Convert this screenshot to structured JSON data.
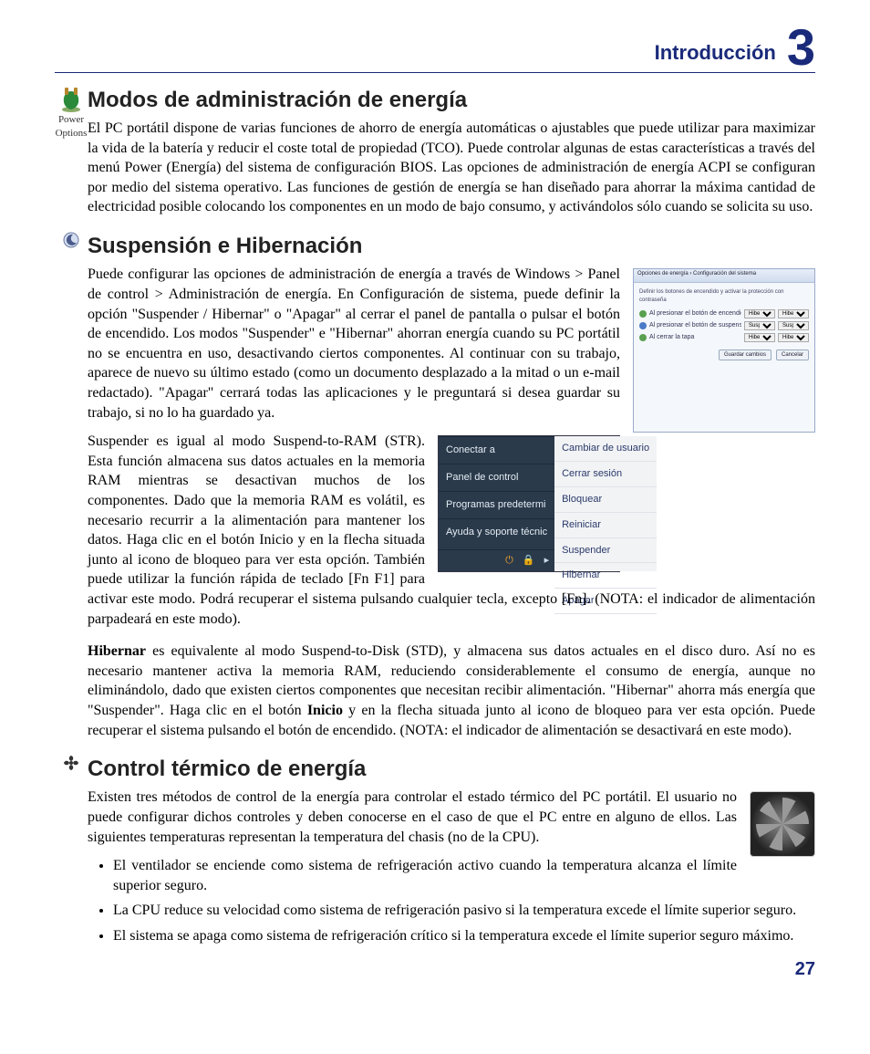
{
  "header": {
    "title": "Introducción",
    "chapter_number": "3"
  },
  "page_number": "27",
  "icons": {
    "power_options_caption_line1": "Power",
    "power_options_caption_line2": "Options"
  },
  "sections": {
    "power_modes": {
      "heading": "Modos de administración de energía",
      "para1": "El PC portátil dispone de varias funciones de ahorro de energía automáticas o ajustables que puede utilizar para maximizar la vida de la batería y reducir el coste total de propiedad (TCO). Puede controlar algunas de estas características a través del menú Power (Energía) del sistema de configuración BIOS. Las opciones de administración de energía ACPI se configuran por medio del sistema operativo. Las funciones de gestión de energía se han diseñado para ahorrar la máxima cantidad de electricidad posible colocando los componentes en un modo de bajo consumo, y activándolos sólo cuando se solicita su uso."
    },
    "suspend_hibernate": {
      "heading": "Suspensión e Hibernación",
      "para1": "Puede configurar las opciones de administración de energía a través de Windows > Panel de control > Administración de energía. En Configuración de sistema, puede definir la opción \"Suspender / Hibernar\" o \"Apagar\" al cerrar el panel de pantalla o pulsar el botón de encendido. Los modos \"Suspender\" e \"Hibernar\" ahorran energía cuando su PC portátil no se encuentra en uso, desactivando ciertos componentes. Al continuar con su trabajo, aparece de nuevo su último estado (como un documento desplazado a la mitad o un e-mail redactado). \"Apagar\" cerrará todas las aplicaciones y le preguntará si desea guardar su trabajo, si no lo ha guardado ya.",
      "para2": "Suspender es igual al modo Suspend-to-RAM (STR). Esta función almacena sus datos actuales en la memoria RAM mientras se desactivan muchos de los componentes. Dado que la memoria RAM es volátil, es necesario recurrir a la alimentación para mantener los datos. Haga clic en el botón Inicio y en la flecha situada junto al icono de bloqueo para ver esta opción. También puede utilizar la función rápida de teclado [Fn F1] para activar este modo. Podrá recuperar el sistema pulsando cualquier tecla, excepto [Fn]. (NOTA: el indicador de alimentación parpadeará en este modo).",
      "para3_prefix_bold": "Hibernar",
      "para3_rest": " es equivalente al modo Suspend-to-Disk (STD), y almacena sus datos actuales en el disco duro. Así no es necesario mantener activa la memoria RAM, reduciendo considerablemente el consumo de energía, aunque no eliminándolo, dado que existen ciertos componentes que necesitan recibir alimentación. \"Hibernar\" ahorra más energía que \"Suspender\". Haga clic en el botón ",
      "para3_bold2": "Inicio",
      "para3_tail": " y en la flecha situada junto al icono de bloqueo para ver esta opción. Puede recuperar el sistema pulsando el botón de encendido. (NOTA: el indicador de alimentación se desactivará en este modo)."
    },
    "thermal": {
      "heading": "Control térmico de energía",
      "para1": "Existen tres métodos de control de la energía para controlar el estado térmico del PC portátil. El usuario no puede configurar dichos controles y deben conocerse en el caso de que el PC entre en alguno de ellos. Las siguientes temperaturas representan la temperatura del chasis (no de la CPU).",
      "bullets": [
        "El ventilador se enciende como sistema de refrigeración activo cuando la temperatura alcanza el límite superior seguro.",
        "La CPU reduce su velocidad como sistema de refrigeración pasivo si la temperatura excede el límite superior seguro.",
        "El sistema se apaga como sistema de refrigeración crítico si la temperatura excede el límite superior seguro máximo."
      ]
    }
  },
  "power_dialog": {
    "title": "Opciones de energía › Configuración del sistema",
    "subtitle": "Definir los botones de encendido y activar la protección con contraseña",
    "rows": [
      {
        "label": "Al presionar el botón de encendido",
        "battery": "Hibernar",
        "plugged": "Hibernar"
      },
      {
        "label": "Al presionar el botón de suspensión",
        "battery": "Suspender",
        "plugged": "Suspender"
      },
      {
        "label": "Al cerrar la tapa",
        "battery": "Hibernar",
        "plugged": "Hibernar"
      }
    ],
    "buttons": {
      "save": "Guardar cambios",
      "cancel": "Cancelar"
    }
  },
  "start_menu": {
    "left": [
      "Conectar a",
      "Panel de control",
      "Programas predetermi",
      "Ayuda y soporte técnic"
    ],
    "right": [
      "Cambiar de usuario",
      "Cerrar sesión",
      "Bloquear",
      "Reiniciar",
      "Suspender",
      "Hibernar",
      "Apagar"
    ]
  }
}
